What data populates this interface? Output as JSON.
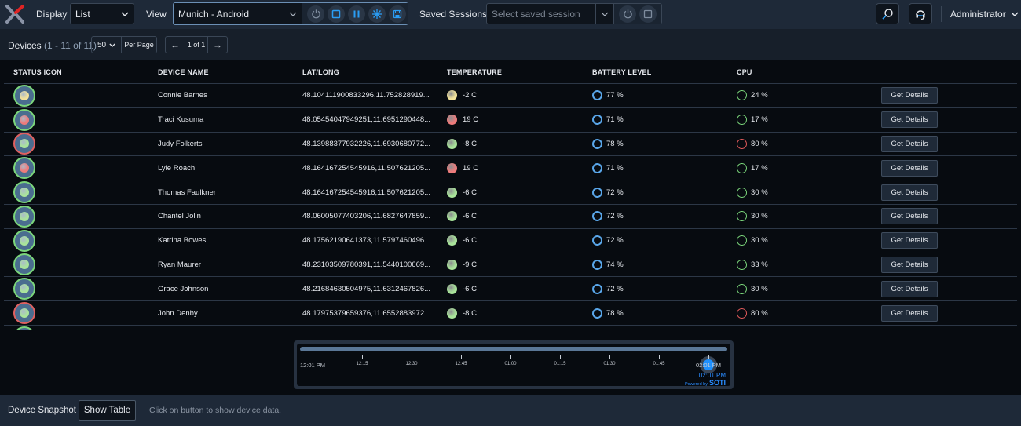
{
  "topbar": {
    "display_label": "Display",
    "display_value": "List",
    "view_label": "View",
    "view_value": "Munich - Android",
    "saved_sessions_label": "Saved Sessions",
    "saved_sessions_placeholder": "Select saved session",
    "user_label": "Administrator"
  },
  "toolbar": {
    "devices_label": "Devices",
    "devices_count": "(1 - 11 of 11)",
    "per_page_value": "50",
    "per_page_label": "Per Page",
    "page_indicator": "1 of 1"
  },
  "table": {
    "headers": [
      "STATUS ICON",
      "DEVICE NAME",
      "LAT/LONG",
      "TEMPERATURE",
      "BATTERY LEVEL",
      "CPU"
    ],
    "action_label": "Get Details",
    "rows": [
      {
        "ring": "green",
        "dot": "yellow",
        "name": "Connie Barnes",
        "latlong": "48.104111900833296,11.752828919...",
        "temp_color": "yellow",
        "temp": "-2 C",
        "battery": "77 %",
        "cpu_color": "green",
        "cpu": "24 %"
      },
      {
        "ring": "green",
        "dot": "red",
        "name": "Traci Kusuma",
        "latlong": "48.05454047949251,11.6951290448...",
        "temp_color": "red",
        "temp": "19 C",
        "battery": "71 %",
        "cpu_color": "green",
        "cpu": "17 %"
      },
      {
        "ring": "red",
        "dot": "green",
        "name": "Judy Folkerts",
        "latlong": "48.13988377932226,11.6930680772...",
        "temp_color": "green",
        "temp": "-8 C",
        "battery": "78 %",
        "cpu_color": "red",
        "cpu": "80 %"
      },
      {
        "ring": "green",
        "dot": "red",
        "name": "Lyle Roach",
        "latlong": "48.164167254545916,11.507621205...",
        "temp_color": "red",
        "temp": "19 C",
        "battery": "71 %",
        "cpu_color": "green",
        "cpu": "17 %"
      },
      {
        "ring": "green",
        "dot": "green",
        "name": "Thomas Faulkner",
        "latlong": "48.164167254545916,11.507621205...",
        "temp_color": "green",
        "temp": "-6 C",
        "battery": "72 %",
        "cpu_color": "green",
        "cpu": "30 %"
      },
      {
        "ring": "green",
        "dot": "green",
        "name": "Chantel Jolin",
        "latlong": "48.06005077403206,11.6827647859...",
        "temp_color": "green",
        "temp": "-6 C",
        "battery": "72 %",
        "cpu_color": "green",
        "cpu": "30 %"
      },
      {
        "ring": "green",
        "dot": "green",
        "name": "Katrina Bowes",
        "latlong": "48.17562190641373,11.5797460496...",
        "temp_color": "green",
        "temp": "-6 C",
        "battery": "72 %",
        "cpu_color": "green",
        "cpu": "30 %"
      },
      {
        "ring": "green",
        "dot": "green",
        "name": "Ryan Maurer",
        "latlong": "48.23103509780391,11.5440100669...",
        "temp_color": "green",
        "temp": "-9 C",
        "battery": "74 %",
        "cpu_color": "green",
        "cpu": "33 %"
      },
      {
        "ring": "green",
        "dot": "green",
        "name": "Grace Johnson",
        "latlong": "48.21684630504975,11.6312467826...",
        "temp_color": "green",
        "temp": "-6 C",
        "battery": "72 %",
        "cpu_color": "green",
        "cpu": "30 %"
      },
      {
        "ring": "red",
        "dot": "green",
        "name": "John Denby",
        "latlong": "48.17975379659376,11.6552883972...",
        "temp_color": "green",
        "temp": "-8 C",
        "battery": "78 %",
        "cpu_color": "red",
        "cpu": "80 %"
      }
    ]
  },
  "timeline": {
    "ticks": [
      "12:01 PM",
      "12:15",
      "12:30",
      "12:45",
      "01:00",
      "01:15",
      "01:30",
      "01:45",
      "02:01 PM"
    ],
    "current_time": "02:01 PM",
    "position": 1.0,
    "powered_by": "Powered by",
    "brand": "SOTI"
  },
  "bottombar": {
    "snapshot_label": "Device Snapshot",
    "show_table_label": "Show Table",
    "hint": "Click on button to show device data."
  },
  "colors": {
    "green": "#a9e59a",
    "yellow": "#f3e39a",
    "red": "#ee7b7b",
    "ring_green": "#7bd67b",
    "ring_red": "#e06060",
    "battery": "#5aa7ea",
    "cpu_green": "#7bd67b",
    "cpu_red": "#e05a5a",
    "accent": "#1e90ff"
  }
}
